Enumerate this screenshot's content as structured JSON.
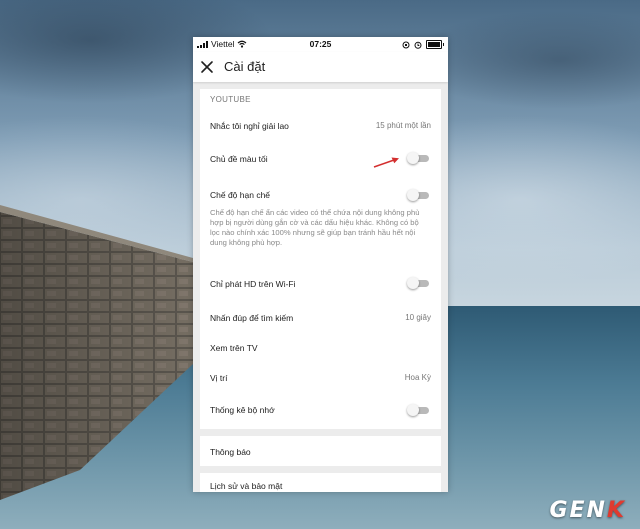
{
  "status_bar": {
    "carrier": "Viettel",
    "time": "07:25"
  },
  "app_bar": {
    "title": "Cài đặt",
    "close_icon": "close-icon"
  },
  "youtube_section": {
    "header": "YOUTUBE",
    "rows": [
      {
        "label": "Nhắc tôi nghỉ giải lao",
        "value": "15 phút một lần"
      },
      {
        "label": "Chủ đề màu tối",
        "toggle": false
      },
      {
        "label": "Chế độ hạn chế",
        "toggle": false,
        "description": "Chế độ hạn chế ẩn các video có thể chứa nội dung không phù hợp bị người dùng gắn cờ và các dấu hiệu khác. Không có bộ lọc nào chính xác 100% nhưng sẽ giúp bạn tránh hầu hết nội dung không phù hợp."
      },
      {
        "label": "Chỉ phát HD trên Wi-Fi",
        "toggle": false
      },
      {
        "label": "Nhấn đúp để tìm kiếm",
        "value": "10 giây"
      },
      {
        "label": "Xem trên TV"
      },
      {
        "label": "Vị trí",
        "value": "Hoa Kỳ"
      },
      {
        "label": "Thống kê bộ nhớ",
        "toggle": false
      }
    ]
  },
  "notifications": {
    "label": "Thông báo"
  },
  "history_privacy": {
    "label": "Lịch sử và bảo mật"
  },
  "watermark": {
    "text": "GEN",
    "accent": "K"
  },
  "colors": {
    "toggle_off_track": "#b9b9b9",
    "arrow": "#d32f2f",
    "background": "#ececec"
  }
}
